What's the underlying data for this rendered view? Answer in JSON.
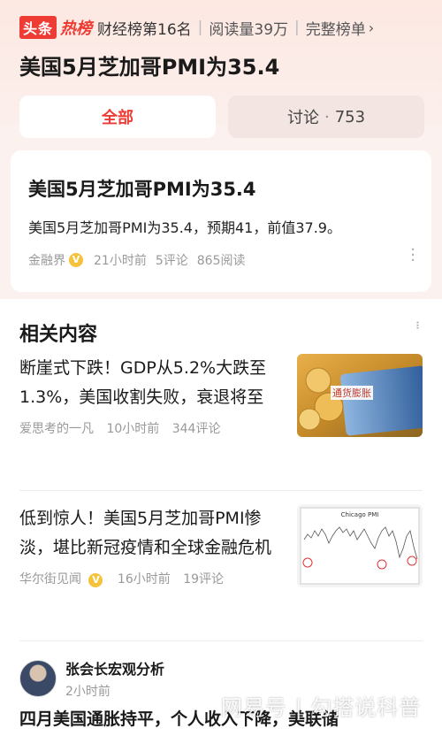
{
  "header": {
    "logo_toutiao": "头条",
    "logo_hot": "热榜",
    "rank": "财经榜第16名",
    "views": "阅读量39万",
    "full_list": "完整榜单",
    "title": "美国5月芝加哥PMI为35.4"
  },
  "tabs": {
    "all": "全部",
    "comment_label": "讨论",
    "comment_count": "753"
  },
  "news_card": {
    "title": "美国5月芝加哥PMI为35.4",
    "body": "美国5月芝加哥PMI为35.4，预期41，前值37.9。",
    "source": "金融界",
    "time": "21小时前",
    "comments": "5评论",
    "reads": "865阅读"
  },
  "related": {
    "heading": "相关内容",
    "items": [
      {
        "title": "断崖式下跌！GDP从5.2%大跌至1.3%，美国收割失败，衰退将至",
        "source": "爱思考的一凡",
        "time": "10小时前",
        "comments": "344评论",
        "thumb_text": "通货膨胀"
      },
      {
        "title": "低到惊人！美国5月芝加哥PMI惨淡，堪比新冠疫情和全球金融危机",
        "source": "华尔街见闻",
        "time": "16小时前",
        "comments": "19评论",
        "thumb_text": "Chicago PMI"
      }
    ]
  },
  "author_post": {
    "name": "张会长宏观分析",
    "time": "2小时前",
    "title_partial": "四月美国通胀持平，个人收入下降，美联储"
  },
  "watermark": "网易号 | 勾搭说科普"
}
